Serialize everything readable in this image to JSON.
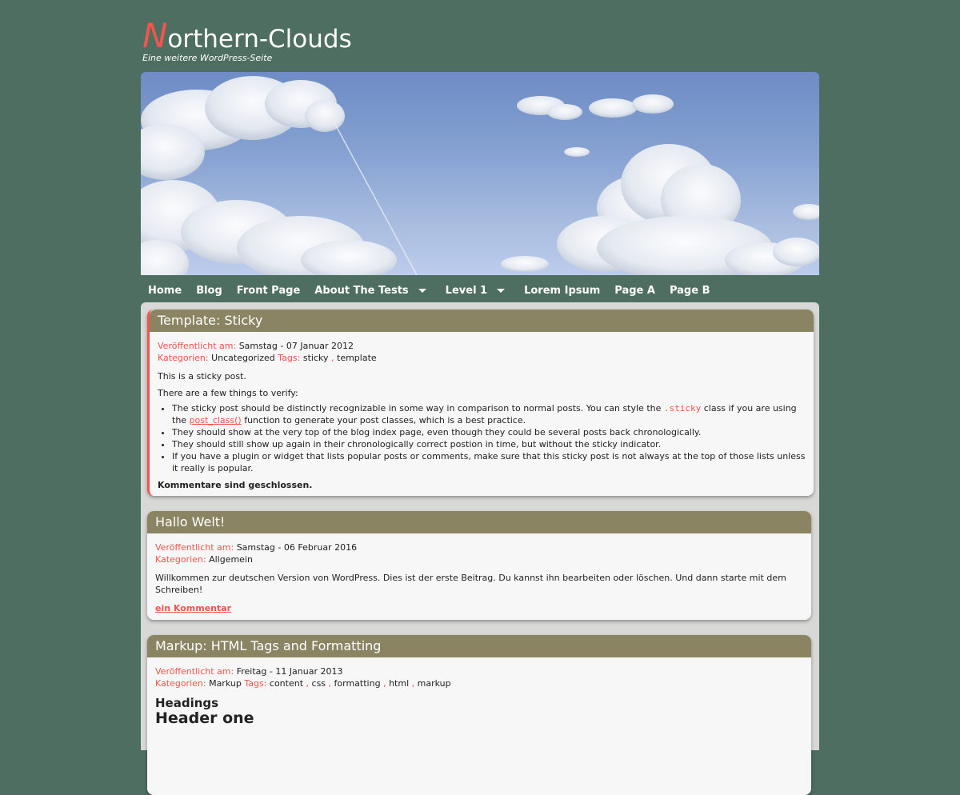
{
  "site": {
    "title_first": "N",
    "title_rest": "orthern-Clouds",
    "tagline": "Eine weitere WordPress-Seite"
  },
  "nav": {
    "items": [
      {
        "label": "Home"
      },
      {
        "label": "Blog"
      },
      {
        "label": "Front Page"
      },
      {
        "label": "About The Tests"
      },
      {
        "label": "Level 1"
      },
      {
        "label": "Lorem Ipsum"
      },
      {
        "label": "Page A"
      },
      {
        "label": "Page B"
      }
    ]
  },
  "posts": [
    {
      "title": "Template: Sticky",
      "published_label": "Veröffentlicht am:",
      "date": "Samstag - 07 Januar 2012",
      "categories_label": "Kategorien:",
      "category": "Uncategorized",
      "tags_label": "Tags:",
      "tags": [
        "sticky",
        "template"
      ],
      "intro": "This is a sticky post.",
      "verify": "There are a few things to verify:",
      "bullet1_a": "The sticky post should be distinctly recognizable in some way in comparison to normal posts. You can style the ",
      "bullet1_code": ".sticky",
      "bullet1_b": " class if you are using the ",
      "bullet1_link": "post_class()",
      "bullet1_c": " function to generate your post classes, which is a best practice.",
      "bullet2": "They should show at the very top of the blog index page, even though they could be several posts back chronologically.",
      "bullet3": "They should still show up again in their chronologically correct postion in time, but without the sticky indicator.",
      "bullet4": "If you have a plugin or widget that lists popular posts or comments, make sure that this sticky post is not always at the top of those lists unless it really is popular.",
      "closed": "Kommentare sind geschlossen."
    },
    {
      "title": "Hallo Welt!",
      "published_label": "Veröffentlicht am:",
      "date": "Samstag - 06 Februar 2016",
      "categories_label": "Kategorien:",
      "category": "Allgemein",
      "body": "Willkommen zur deutschen Version von WordPress. Dies ist der erste Beitrag. Du kannst ihn bearbeiten oder löschen. Und dann starte mit dem Schreiben!",
      "comment_link": "ein Kommentar"
    },
    {
      "title": "Markup: HTML Tags and Formatting",
      "published_label": "Veröffentlicht am:",
      "date": "Freitag - 11 Januar 2013",
      "categories_label": "Kategorien:",
      "category": "Markup",
      "tags_label": "Tags:",
      "tags": [
        "content",
        "css",
        "formatting",
        "html",
        "markup"
      ],
      "heading": "Headings",
      "header_one": "Header one"
    }
  ],
  "colors": {
    "background": "#4d6e60",
    "accent": "#f2554b",
    "post_header": "#8b8463",
    "post_bg": "#f7f7f7"
  },
  "icons": {
    "dropdown": "caret-down-icon"
  }
}
